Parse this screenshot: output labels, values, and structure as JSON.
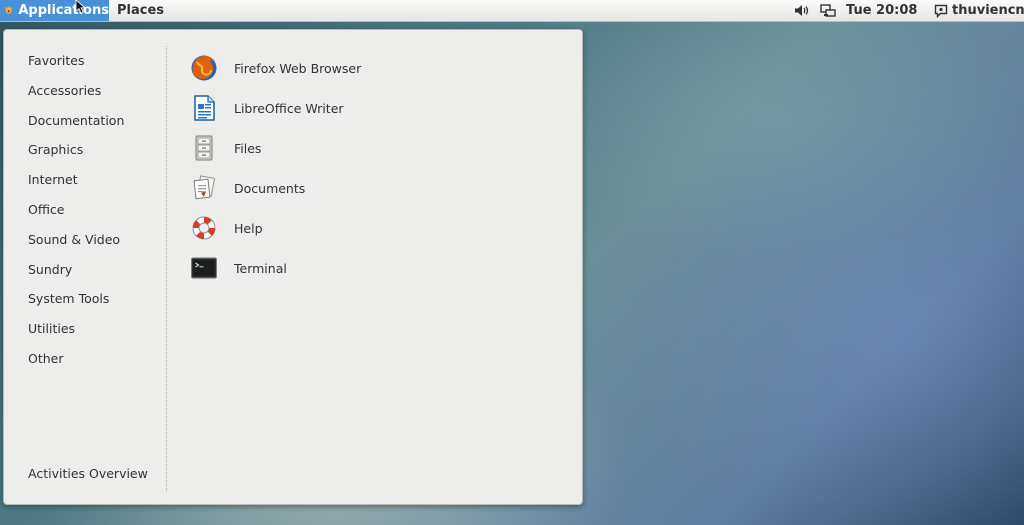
{
  "topbar": {
    "applications_label": "Applications",
    "places_label": "Places",
    "clock": "Tue 20:08",
    "user": "thuviencntt"
  },
  "menu": {
    "categories": [
      {
        "label": "Favorites"
      },
      {
        "label": "Accessories"
      },
      {
        "label": "Documentation"
      },
      {
        "label": "Graphics"
      },
      {
        "label": "Internet"
      },
      {
        "label": "Office"
      },
      {
        "label": "Sound & Video"
      },
      {
        "label": "Sundry"
      },
      {
        "label": "System Tools"
      },
      {
        "label": "Utilities"
      },
      {
        "label": "Other"
      }
    ],
    "activities_label": "Activities Overview",
    "apps": [
      {
        "label": "Firefox Web Browser",
        "icon": "firefox-icon"
      },
      {
        "label": "LibreOffice Writer",
        "icon": "libreoffice-writer-icon"
      },
      {
        "label": "Files",
        "icon": "files-cabinet-icon"
      },
      {
        "label": "Documents",
        "icon": "documents-icon"
      },
      {
        "label": "Help",
        "icon": "help-lifebuoy-icon"
      },
      {
        "label": "Terminal",
        "icon": "terminal-icon"
      }
    ]
  },
  "colors": {
    "accent": "#4a90d9",
    "panel_bg": "#ededec",
    "text": "#2e3436"
  }
}
